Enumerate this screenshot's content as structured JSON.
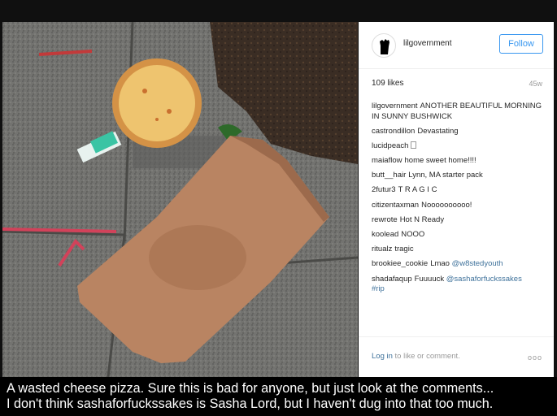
{
  "post": {
    "username": "lilgovernment",
    "follow_label": "Follow",
    "likes": "109 likes",
    "age": "45w",
    "caption_user": "lilgovernment",
    "caption_text": "ANOTHER BEAUTIFUL MORNING IN SUNNY BUSHWICK",
    "comments": [
      {
        "user": "castrondillon",
        "text": "Devastating"
      },
      {
        "user": "lucidpeach",
        "text": ""
      },
      {
        "user": "maiaflow",
        "text": "home sweet home!!!!"
      },
      {
        "user": "butt__hair",
        "text": "Lynn, MA starter pack"
      },
      {
        "user": "2futur3",
        "text": "T R A G I C"
      },
      {
        "user": "citizentaxman",
        "text": "Noooooooooo!"
      },
      {
        "user": "rewrote",
        "text": "Hot N Ready"
      },
      {
        "user": "koolead",
        "text": "NOOO"
      },
      {
        "user": "ritualz",
        "text": "tragic"
      },
      {
        "user": "brookiee_cookie",
        "text": "Lmao ",
        "mention": "@w8stedyouth"
      },
      {
        "user": "shadafaqup",
        "text": "Fuuuuck ",
        "mention": "@sashaforfuckssakes",
        "tag": "#rip"
      }
    ],
    "footer": {
      "login_link": "Log in",
      "login_rest": " to like or comment.",
      "more_icon": "ooo"
    }
  },
  "caption": {
    "line1": "A wasted cheese pizza. Sure this is bad for anyone, but just look at the comments...",
    "line2": "I don't think sashaforfuckssakes is Sasha Lord, but I haven't dug into that too much."
  },
  "colors": {
    "link": "#3f729b",
    "follow": "#3897f0",
    "pizza_box": "#b98462",
    "pizza": "#e7a35a"
  }
}
